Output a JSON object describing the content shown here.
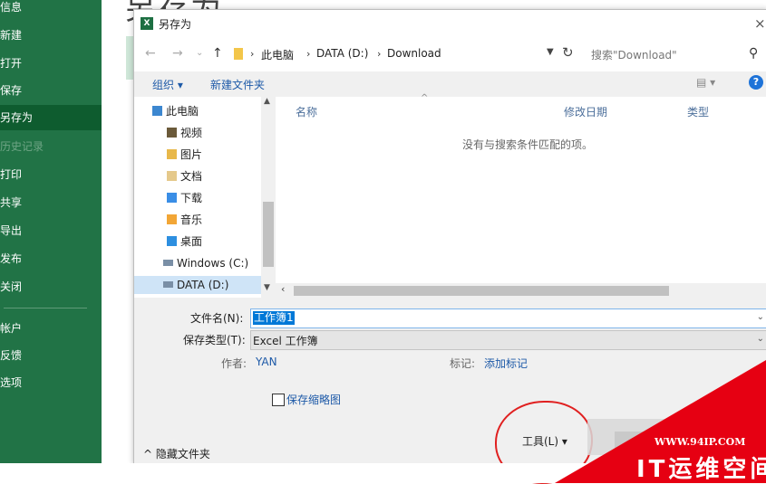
{
  "sidebar": {
    "items": [
      {
        "label": "信息"
      },
      {
        "label": "新建"
      },
      {
        "label": "打开"
      },
      {
        "label": "保存"
      },
      {
        "label": "另存为"
      },
      {
        "label": "历史记录"
      },
      {
        "label": "打印"
      },
      {
        "label": "共享"
      },
      {
        "label": "导出"
      },
      {
        "label": "发布"
      },
      {
        "label": "关闭"
      },
      {
        "label": "帐户"
      },
      {
        "label": "反馈"
      },
      {
        "label": "选项"
      }
    ]
  },
  "page": {
    "title": "另存为"
  },
  "dialog": {
    "title": "另存为",
    "app_icon_letter": "X",
    "close_glyph": "×",
    "nav": {
      "back": "←",
      "forward": "→",
      "recent": "⌄",
      "up": "↑",
      "sep": "›",
      "path": [
        "此电脑",
        "DATA (D:)",
        "Download"
      ],
      "search_placeholder": "搜索\"Download\""
    },
    "toolbar": {
      "organize": "组织 ▾",
      "new_folder": "新建文件夹",
      "view": "▤ ▾",
      "help": "?"
    },
    "tree": [
      {
        "label": "此电脑",
        "icon_color": "#3c87d0"
      },
      {
        "label": "视频",
        "icon_color": "#6b5a3a"
      },
      {
        "label": "图片",
        "icon_color": "#e8b84a"
      },
      {
        "label": "文档",
        "icon_color": "#e5c98b"
      },
      {
        "label": "下载",
        "icon_color": "#3a8ee6"
      },
      {
        "label": "音乐",
        "icon_color": "#f2a636"
      },
      {
        "label": "桌面",
        "icon_color": "#2d8fe0"
      },
      {
        "label": "Windows (C:)",
        "icon_color": "#7a8fa6"
      },
      {
        "label": "DATA (D:)",
        "icon_color": "#7a8fa6"
      }
    ],
    "columns": {
      "name": "名称",
      "modified": "修改日期",
      "type": "类型"
    },
    "empty_message": "没有与搜索条件匹配的项。",
    "form": {
      "filename_label": "文件名(N):",
      "filename_value": "工作簿1",
      "filetype_label": "保存类型(T):",
      "filetype_value": "Excel 工作簿",
      "author_label": "作者:",
      "author_value": "YAN",
      "tags_label": "标记:",
      "tags_value": "添加标记",
      "thumbnail_label": "保存缩略图",
      "hide_folders": "^ 隐藏文件夹",
      "tools": "工具(L)  ▾"
    }
  },
  "watermark": {
    "url": "WWW.94IP.COM",
    "brand": "IT运维空间"
  },
  "colors": {
    "excel_green": "#217346",
    "link_blue": "#1e5aa8",
    "watermark_red": "#e60012"
  }
}
